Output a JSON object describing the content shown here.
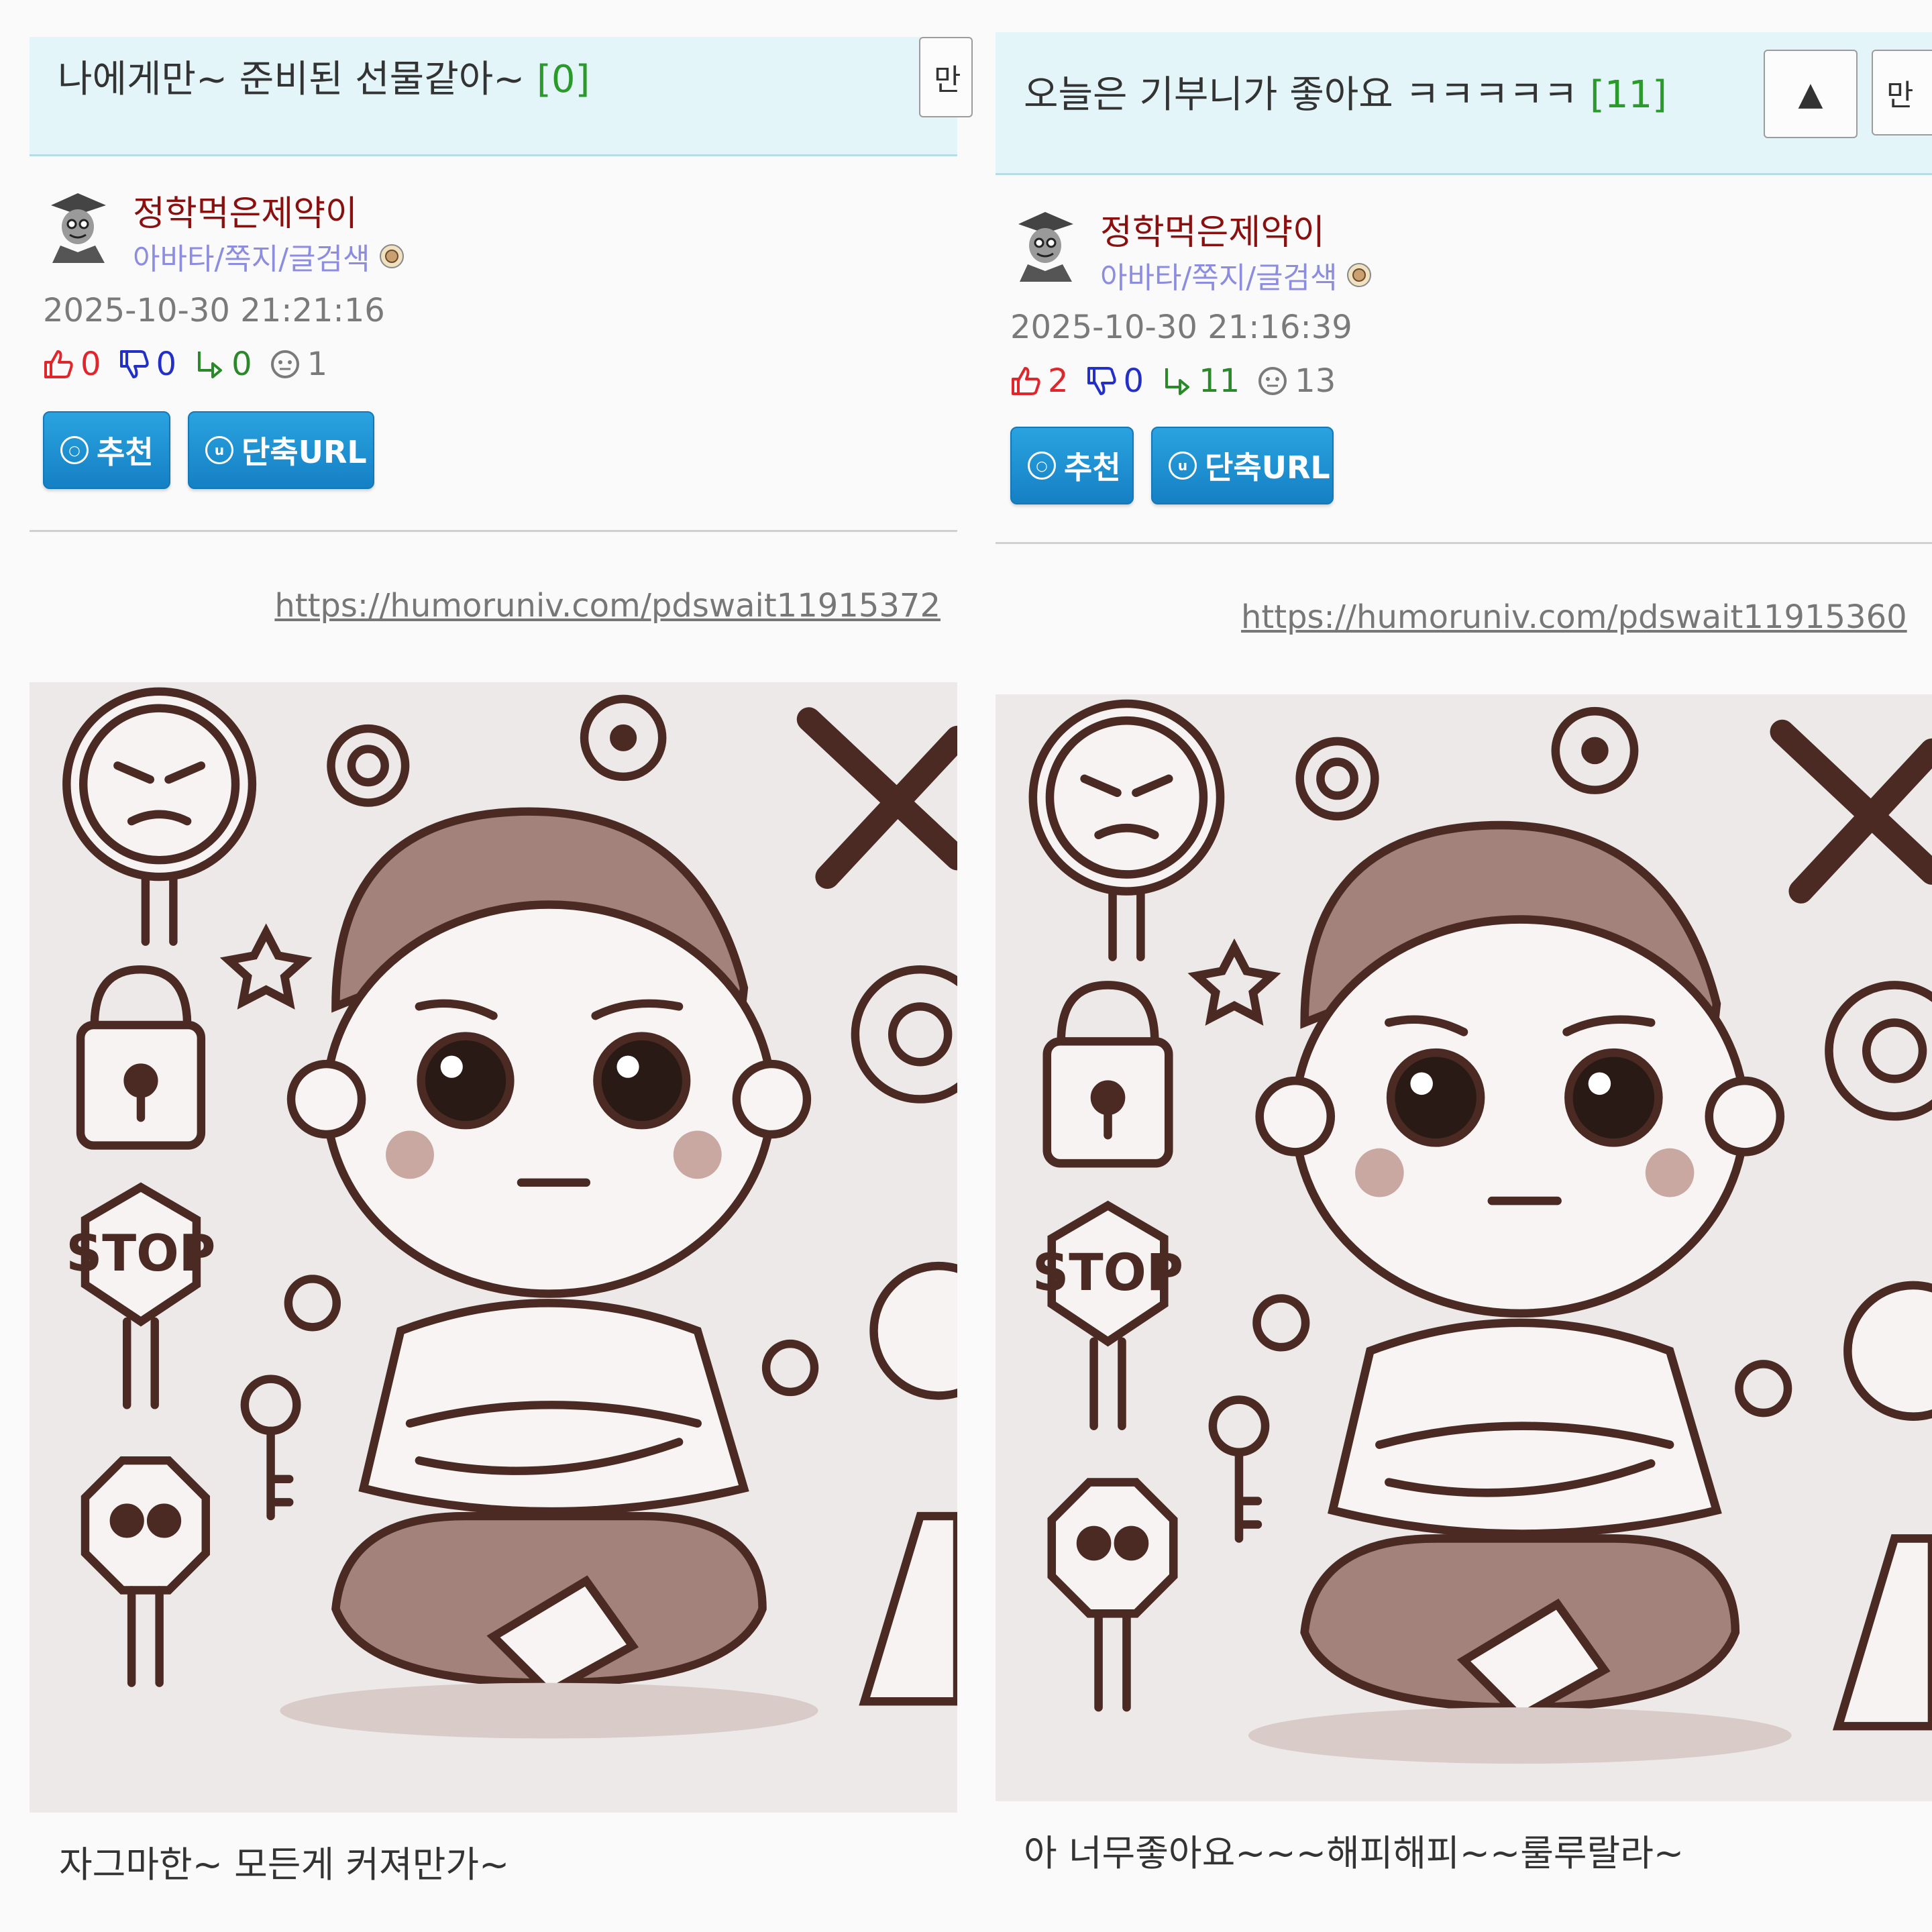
{
  "posts": [
    {
      "title": "나에게만~ 준비된 선물같아~",
      "comment_count": "[0]",
      "more_label": "만",
      "author_name": "정학먹은제약이",
      "author_links": "아바타/쪽지/글검색",
      "date": "2025-10-30 21:21:16",
      "likes": "0",
      "dislikes": "0",
      "replies": "0",
      "views": "1",
      "recommend_label": "추천",
      "shorturl_label": "단축URL",
      "link_text": "https://humoruniv.com/pdswait11915372",
      "body_text": "자그마한~ 모든게 커져만가~",
      "image_stop_text": "STOP"
    },
    {
      "title": "오늘은 기부니가 좋아요 ㅋㅋㅋㅋㅋ",
      "comment_count": "[11]",
      "up_label": "▲",
      "more_label": "만",
      "author_name": "정학먹은제약이",
      "author_links": "아바타/쪽지/글검색",
      "date": "2025-10-30 21:16:39",
      "likes": "2",
      "dislikes": "0",
      "replies": "11",
      "views": "13",
      "recommend_label": "추천",
      "shorturl_label": "단축URL",
      "link_text": "https://humoruniv.com/pdswait11915360",
      "body_text": "아 너무좋아요~~~해피해피~~룰루랄라~",
      "image_stop_text": "STOP"
    }
  ],
  "colors": {
    "header_bg": "#e3f5f9",
    "author": "#8a1010",
    "links": "#8c8ce0",
    "like": "#e0252b",
    "dislike": "#2230c8",
    "reply": "#2a8a2a",
    "button": "#1a8fd2"
  },
  "icons": [
    "thumbs-up-icon",
    "thumbs-down-icon",
    "reply-arrow-icon",
    "view-face-icon",
    "recommend-circle-icon",
    "url-circle-icon",
    "badge-icon",
    "avatar-icon"
  ]
}
